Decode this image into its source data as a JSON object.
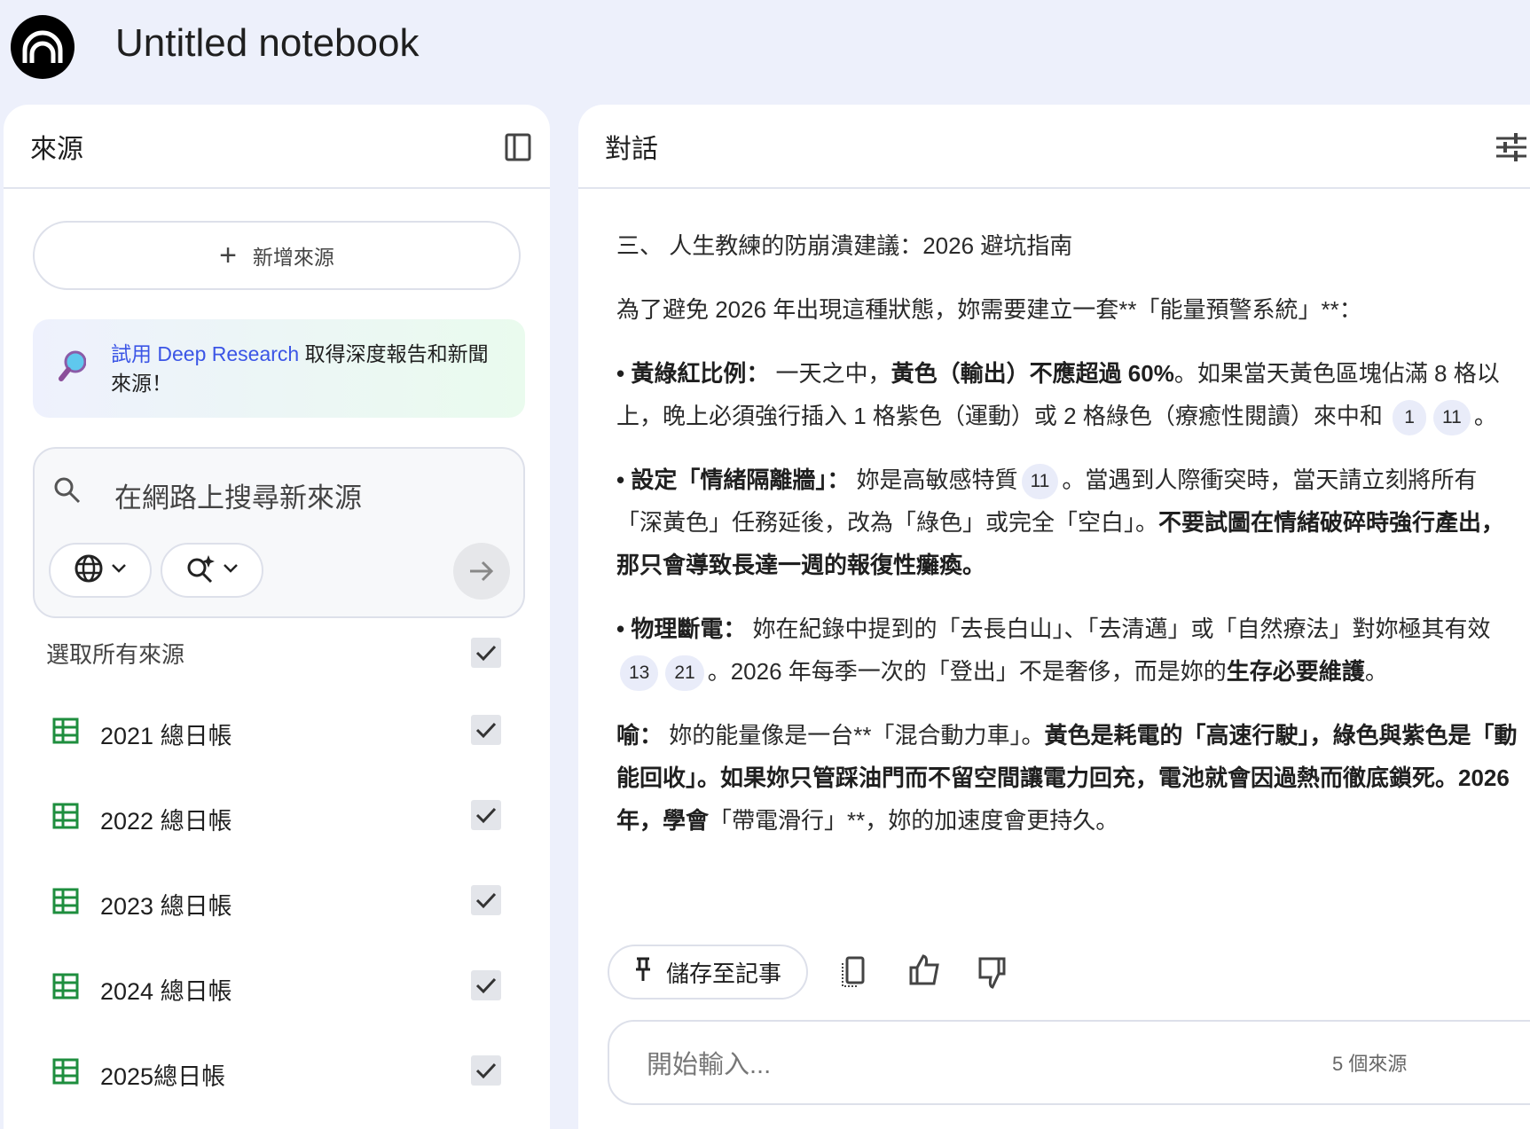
{
  "app": {
    "title": "Untitled notebook"
  },
  "sources_panel": {
    "title": "來源",
    "add_source": "新增來源",
    "banner": {
      "link": "試用 Deep Research",
      "text": " 取得深度報告和新聞來源！"
    },
    "search": {
      "placeholder": "在網路上搜尋新來源"
    },
    "select_all": "選取所有來源",
    "items": [
      {
        "label": "2021 總日帳",
        "checked": true
      },
      {
        "label": "2022 總日帳",
        "checked": true
      },
      {
        "label": "2023 總日帳",
        "checked": true
      },
      {
        "label": "2024 總日帳",
        "checked": true
      },
      {
        "label": "2025總日帳",
        "checked": true
      }
    ]
  },
  "chat_panel": {
    "title": "對話",
    "paragraphs": [
      [
        {
          "t": "三、 人生教練的防崩潰建議：2026 避坑指南"
        }
      ],
      [
        {
          "t": "為了避免 2026 年出現這種狀態，妳需要建立一套**「能量預警系統」**："
        }
      ],
      [
        {
          "t": "• 黃綠紅比例：",
          "b": true
        },
        {
          "t": " 一天之中，"
        },
        {
          "t": "黃色（輸出）不應超過 60%",
          "b": true
        },
        {
          "t": "。如果當天黃色區塊佔滿 8 格以上，晚上必須強行插入 1 格紫色（運動）或 2 格綠色（療癒性閱讀）來中和 "
        },
        {
          "c": "1"
        },
        {
          "c": "11"
        },
        {
          "t": "。"
        }
      ],
      [
        {
          "t": "• 設定「情緒隔離牆」：",
          "b": true
        },
        {
          "t": " 妳是高敏感特質"
        },
        {
          "c": "11"
        },
        {
          "t": "。當遇到人際衝突時，當天請立刻將所有「深黃色」任務延後，改為「綠色」或完全「空白」。"
        },
        {
          "t": "不要試圖在情緒破碎時強行產出，那只會導致長達一週的報復性癱瘓。",
          "b": true
        }
      ],
      [
        {
          "t": "• 物理斷電：",
          "b": true
        },
        {
          "t": " 妳在紀錄中提到的「去長白山」、「去清邁」或「自然療法」對妳極其有效"
        },
        {
          "c": "13"
        },
        {
          "c": "21"
        },
        {
          "t": "。2026 年每季一次的「登出」不是奢侈，而是妳的"
        },
        {
          "t": "生存必要維護",
          "b": true
        },
        {
          "t": "。"
        }
      ],
      [
        {
          "t": "喻：",
          "b": true
        },
        {
          "t": " 妳的能量像是一台**「混合動力車」。"
        },
        {
          "t": "黃色是耗電的「高速行駛」，綠色與紫色是「動能回收」。如果妳只管踩油門而不留空間讓電力回充，電池就會因過熱而徹底鎖死。2026 年，學會",
          "b": true
        },
        {
          "t": "「帶電滑行」**，妳的加速度會更持久。"
        }
      ]
    ],
    "save_note": "儲存至記事",
    "input_placeholder": "開始輸入...",
    "source_count": "5 個來源"
  }
}
